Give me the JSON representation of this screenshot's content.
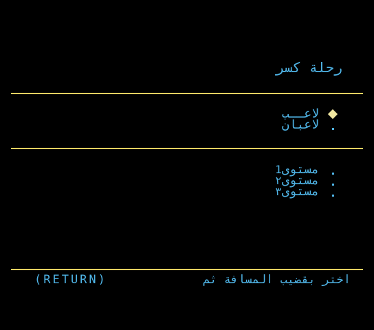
{
  "title": "رحلة كسر",
  "colors": {
    "background": "#000000",
    "text": "#4fb4e6",
    "rule": "#e8d060",
    "cursor": "#f0e6a0"
  },
  "players_menu": {
    "items": [
      {
        "label": "لاعــب",
        "selected": true,
        "marker_icon": "diamond-cursor-icon"
      },
      {
        "label": "لاعبان",
        "selected": false,
        "marker_icon": "dot-icon"
      }
    ]
  },
  "levels_menu": {
    "items": [
      {
        "label": "مستوى",
        "number": "1",
        "marker_icon": "dot-icon"
      },
      {
        "label": "مستوى",
        "number": "٢",
        "marker_icon": "dot-icon"
      },
      {
        "label": "مستوى",
        "number": "٣",
        "marker_icon": "dot-icon"
      }
    ]
  },
  "footer": {
    "instruction": "اختر بقضيب المسافة ثم",
    "key": "(RETURN)"
  }
}
